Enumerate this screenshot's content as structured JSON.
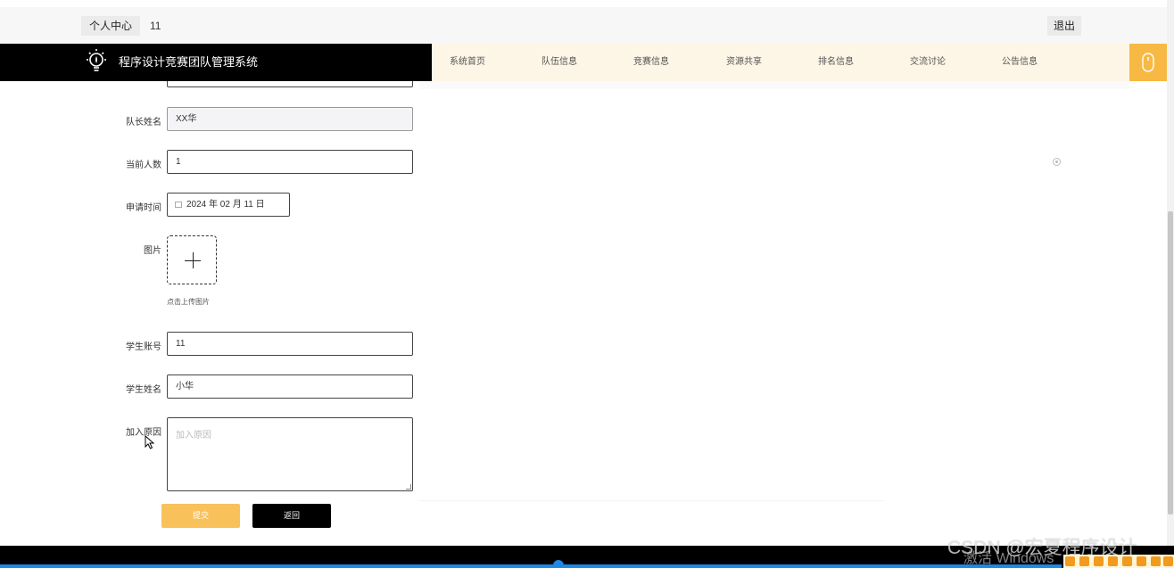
{
  "userbar": {
    "center_label": "个人中心",
    "username": "11",
    "logout_label": "退出"
  },
  "header": {
    "title": "程序设计竞赛团队管理系统"
  },
  "nav": {
    "items": [
      "系统首页",
      "队伍信息",
      "竞赛信息",
      "资源共享",
      "排名信息",
      "交流讨论",
      "公告信息"
    ]
  },
  "form": {
    "captain_name": {
      "label": "队长姓名",
      "value": "XX华"
    },
    "current_count": {
      "label": "当前人数",
      "value": "1"
    },
    "apply_time": {
      "label": "申请时间",
      "value": "2024 年 02 月 11 日"
    },
    "image": {
      "label": "图片",
      "hint": "点击上传图片"
    },
    "student_account": {
      "label": "学生账号",
      "value": "11"
    },
    "student_name": {
      "label": "学生姓名",
      "value": "小华"
    },
    "join_reason": {
      "label": "加入原因",
      "placeholder": "加入原因"
    },
    "submit_label": "提交",
    "back_label": "返回"
  },
  "watermark": {
    "text": "CSDN @宏夏程序设计",
    "dim_text": "激活 Windows"
  },
  "colors": {
    "accent": "#f8c15a",
    "nav_bg": "#fdf5e6",
    "header_bg": "#000000",
    "mouse_btn": "#f7b944"
  }
}
